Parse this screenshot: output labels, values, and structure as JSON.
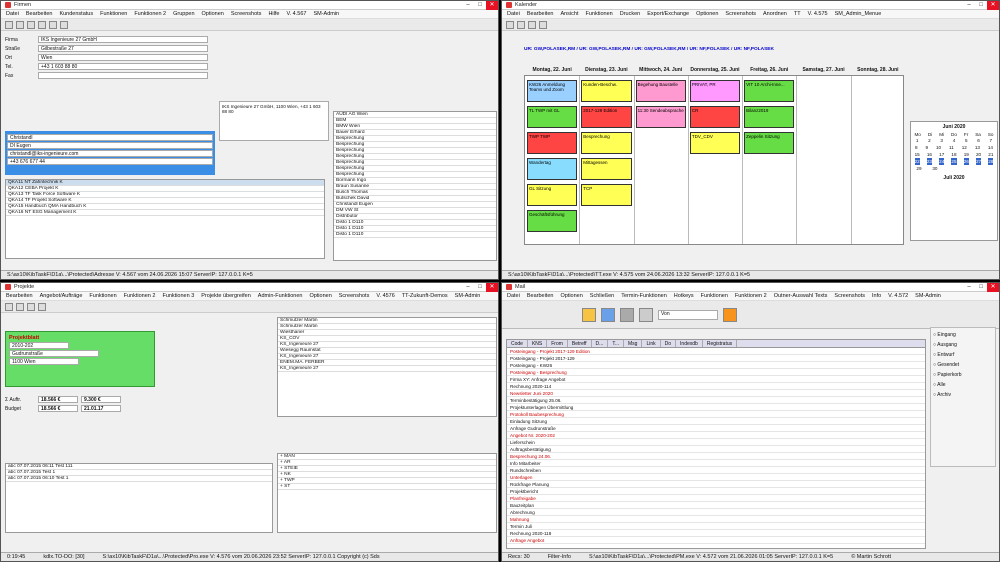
{
  "w1": {
    "title": "Firmen",
    "menu": [
      "Datei",
      "Bearbeiten",
      "Kundenstatus",
      "Funktionen",
      "Funktionen 2",
      "Gruppen",
      "Optionen",
      "Screenshots",
      "Hilfe",
      "V. 4.567",
      "SM-Admin"
    ],
    "company": "IKS Ingenieure 27 GmbH",
    "street": "Gilbestraße 27",
    "city": "Wien",
    "phone": "+43 1 603 88 80",
    "fax": "",
    "contact_name": "Christandl",
    "contact_title": "DI Eugen",
    "contact_email": "christandl@iks-ingenieure.com",
    "contact_phone": "+43 676 677 44",
    "address_block": "IKS Ingenieure 27 GmbH, 1100 Wien, +43 1 603 88 80",
    "rows": [
      {
        "code": "QKA11",
        "type": "NT",
        "name": "Zahntechnik",
        "status": "K"
      },
      {
        "code": "QKA12",
        "type": "CEBA",
        "name": "Projekt",
        "status": "K"
      },
      {
        "code": "QKA13",
        "type": "TF",
        "name": "Task Force Software",
        "status": "K"
      },
      {
        "code": "QKA14",
        "type": "TF",
        "name": "Projekt Software",
        "status": "K"
      },
      {
        "code": "QKA15",
        "type": "Handbuch",
        "name": "QMA Handbuch",
        "status": "K"
      },
      {
        "code": "QKA16",
        "type": "NT",
        "name": "ESG Management",
        "status": "K"
      }
    ],
    "contacts": [
      "AUDI AG Wien",
      "BEM",
      "BMW Wien",
      "Bauer Erhard",
      "Besprechung",
      "Besprechung",
      "Besprechung",
      "Besprechung",
      "Besprechung",
      "Besprechung",
      "Besprechung",
      "Bormann Ingo",
      "Braun Susanne",
      "Busch Thomas",
      "Butschek David",
      "Christandl Eugen",
      "DM VW St",
      "Distributor",
      "Disto 1 D110",
      "Disto 1 D110",
      "Disto 1 D110"
    ],
    "status": "S:\\ax10\\KibTaskF\\D1a\\...\\Protected\\Adresse   V: 4.567 vom 24.06.2026 15:07   ServerIP: 127.0.0.1 K=5"
  },
  "w2": {
    "title": "Kalender",
    "menu": [
      "Datei",
      "Bearbeiten",
      "Ansicht",
      "Funktionen",
      "Drucken",
      "Export/Exchange",
      "Optionen",
      "Screenshots",
      "Anordnen",
      "TT",
      "V. 4.575",
      "SM_Admin_Menue"
    ],
    "days": [
      "Montag, 22. Juni",
      "Dienstag, 23. Juni",
      "Mittwoch, 24. Juni",
      "Donnerstag, 25. Juni",
      "Freitag, 26. Juni",
      "Samstag, 27. Juni",
      "Sonntag, 28. Juni"
    ],
    "users": "UR: GW,POLASEK,RM / UR: GW,POLASEK,RM / UR: GW,POLASEK,RM / UR: NF,POLASEK / UR: NF,POLASEK",
    "events": [
      {
        "label": "KW26 Anmeldung Teams und Zoom",
        "col": 0,
        "color": "#9ad0ff"
      },
      {
        "label": "TL TWP mit GL",
        "col": 0,
        "color": "#66dd44"
      },
      {
        "label": "TWP TWP",
        "col": 0,
        "color": "#ff4444"
      },
      {
        "label": "Wandertag",
        "col": 0,
        "color": "#88ddff"
      },
      {
        "label": "GL Sitzung",
        "col": 0,
        "color": "#ffff55"
      },
      {
        "label": "Geschäftsführung",
        "col": 0,
        "color": "#66dd44"
      },
      {
        "label": "Kunden-Beschw.",
        "col": 1,
        "color": "#ffff55"
      },
      {
        "label": "2017-129 Edition",
        "col": 1,
        "color": "#ff4444"
      },
      {
        "label": "Besprechung",
        "col": 1,
        "color": "#ffff55"
      },
      {
        "label": "Mittagessen",
        "col": 1,
        "color": "#ffff55"
      },
      {
        "label": "TCP",
        "col": 1,
        "color": "#ffff55"
      },
      {
        "label": "Begehung Baustelle",
        "col": 2,
        "color": "#ff9ad0"
      },
      {
        "label": "11:30 Sendeabsprache",
        "col": 2,
        "color": "#ff9ad0"
      },
      {
        "label": "PRIVAT, PR",
        "col": 3,
        "color": "#ff99ff"
      },
      {
        "label": "CR",
        "col": 3,
        "color": "#ff4444"
      },
      {
        "label": "TDV_CDV",
        "col": 3,
        "color": "#ffff55"
      },
      {
        "label": "VIT 10 Archi-Inne...",
        "col": 4,
        "color": "#66dd44"
      },
      {
        "label": "Bilanz2019",
        "col": 4,
        "color": "#66dd44"
      },
      {
        "label": "Zeppelin Sitzung",
        "col": 4,
        "color": "#66dd44"
      }
    ],
    "cal_month": "Juni 2020",
    "cal_month2": "Juli 2020",
    "cal_days": [
      "Mo",
      "Di",
      "Mi",
      "Do",
      "Fr",
      "Sa",
      "So"
    ],
    "status": "S:\\ax10\\KibTaskF\\D1a\\...\\Protected\\TT.exe   V: 4.575 vom 24.06.2026 13:32   ServerIP: 127.0.0.1 K=5"
  },
  "w3": {
    "title": "Projekte",
    "menu": [
      "Bearbeiten",
      "Angebot/Aufträge",
      "Funktionen",
      "Funktionen 2",
      "Funktionen 3",
      "Projekte übergreifen",
      "Admin-Funktionen",
      "Optionen",
      "Screenshots",
      "V. 4576",
      "TT-Zukunft-Demos",
      "SM-Admin"
    ],
    "project_label": "Projektblatt",
    "project_no": "2010-202",
    "project_name": "Gudrunstraße",
    "area": "1100 Wien",
    "sum_label": "18.566 €",
    "budget": "18.566 €",
    "sum2": "9.300 €",
    "total": "21.01.17",
    "staff": [
      "Schmutzer Martin",
      "Schmutzer Martin",
      "Wiesthaner",
      "KS_COV",
      "KS_Ingenieure 27",
      "Wiesegg Raumstat",
      "KS_Ingenieure 27",
      "ENEM.MA. FERBER",
      "KS_Ingenieure 27"
    ],
    "tree": [
      "MAN",
      "AR",
      "STEIE",
      "NK",
      "TWP",
      "ST"
    ],
    "notes": [
      "abc 07.07.2015 06:11 Test 111",
      "abc 07.07.2015 Test 1",
      "abc 07.07.2015 06:10 Test 1"
    ],
    "status": "S:\\ax10\\KibTaskF\\D1a\\...\\Protected\\Pro.exe   V: 4.576 vom 20.06.2026 23:52   ServerIP: 127.0.0.1   Copyright (c) Sds",
    "status_left": "0:19:45",
    "status_mid": "kdlx.TO-DO: [30]"
  },
  "w4": {
    "title": "Mail",
    "menu": [
      "Datei",
      "Bearbeiten",
      "Optionen",
      "Schließen",
      "Termin-Funktionen",
      "Hotkeys",
      "Funktionen",
      "Funktionen 2",
      "Outner-Auswahl Texts",
      "Screenshots",
      "Info",
      "V. 4.572",
      "SM-Admin"
    ],
    "columns": [
      "Code",
      "KNS",
      "From",
      "Betreff",
      "D...",
      "T...",
      "Msg",
      "Link",
      "Do",
      "Indexdb",
      "Registratus"
    ],
    "mails": [
      "Posteingang - Projekt 2017-129 Edition",
      "Posteingang - Projekt 2017-129",
      "Posteingang - KW26",
      "Posteingang - Besprechung",
      "Firma XY: Anfrage Angebot",
      "Rechnung 2020-114",
      "Newsletter Juni 2020",
      "Terminbestätigung 25.06.",
      "Projektunterlagen Übermittlung",
      "Protokoll Baubesprechung",
      "Einladung Sitzung",
      "Anfrage Gudrunstraße",
      "Angebot Nr. 2020-202",
      "Lieferschein",
      "Auftragsbestätigung",
      "Besprechung 24.06.",
      "Info Mitarbeiter",
      "Rundschreiben",
      "Unterlagen",
      "Rückfrage Planung",
      "Projektbericht",
      "Planfreigabe",
      "Bauzeitplan",
      "Abrechnung",
      "Mahnung",
      "Termin Juli",
      "Rechnung 2020-118",
      "Anfrage Angebot"
    ],
    "options": [
      "Eingang",
      "Ausgang",
      "Entwurf",
      "Gesendet",
      "Papierkorb",
      "Alle",
      "Archiv"
    ],
    "search": "Von",
    "status": "S:\\ax10\\KibTaskF\\D1a\\...\\Protected\\PM.exe   V: 4.572 vom 21.06.2026 01:05   ServerIP: 127.0.0.1 K=5",
    "status_left": "Recs: 30",
    "status_filter": "Filter-Info",
    "copyright": "© Martin Schrott"
  }
}
